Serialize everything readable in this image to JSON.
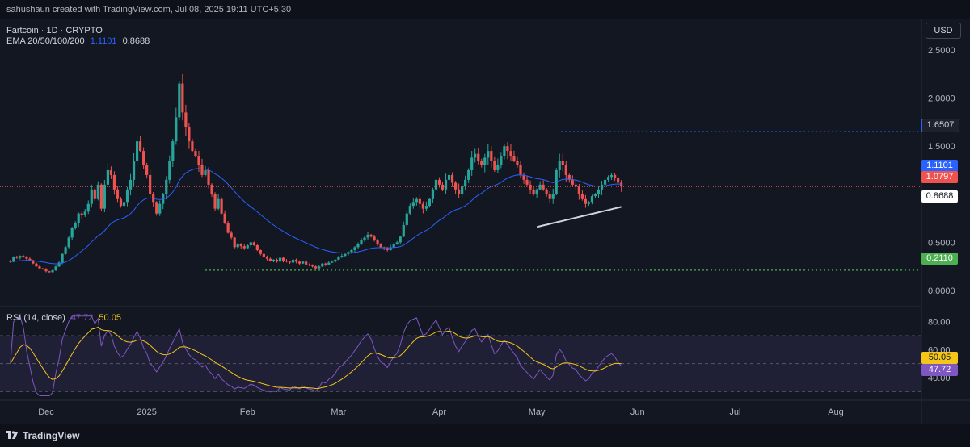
{
  "header": {
    "attribution": "sahushaun created with TradingView.com, Jul 08, 2025 19:11 UTC+5:30"
  },
  "legend": {
    "symbol": "Fartcoin · 1D · CRYPTO",
    "ema_label": "EMA 20/50/100/200",
    "ema_value_1": "1.1101",
    "ema_value_2": "0.8688"
  },
  "currency_button": "USD",
  "rsi_legend": {
    "label": "RSI (14, close)",
    "value": "47.72",
    "ma_value": "50.05"
  },
  "price_badges": {
    "resistance": "1.6507",
    "ema50": "1.1101",
    "last": "1.0797",
    "ema200": "0.8688",
    "support": "0.2110"
  },
  "rsi_badges": {
    "ma": "50.05",
    "rsi": "47.72"
  },
  "footer": {
    "brand": "TradingView"
  },
  "colors": {
    "bg": "#131722",
    "up": "#26a69a",
    "down": "#ef5350",
    "ema_blue": "#2962ff",
    "ema_white": "#d1d4dc",
    "rsi": "#7e57c2",
    "rsi_ma": "#f5c518",
    "resistance": "#2962ff",
    "support": "#4caf50"
  },
  "chart_data": [
    {
      "type": "candlestick",
      "title": "Fartcoin · 1D · CRYPTO",
      "y_axis_ticks": [
        "2.5000",
        "2.0000",
        "1.5000",
        "1.0000",
        "0.5000",
        "0.0000"
      ],
      "ylim": [
        -0.1,
        2.75
      ],
      "x_axis_ticks": [
        "Dec",
        "2025",
        "Feb",
        "Mar",
        "Apr",
        "May",
        "Jun",
        "Jul",
        "Aug"
      ],
      "x_tick_dates": [
        "2024-12-01",
        "2025-01-01",
        "2025-02-01",
        "2025-03-01",
        "2025-04-01",
        "2025-05-01",
        "2025-06-01",
        "2025-07-01",
        "2025-08-01"
      ],
      "close_series": {
        "start_date": "2024-11-20",
        "values": [
          0.3,
          0.35,
          0.34,
          0.36,
          0.35,
          0.33,
          0.31,
          0.28,
          0.25,
          0.23,
          0.22,
          0.2,
          0.19,
          0.21,
          0.25,
          0.29,
          0.38,
          0.45,
          0.55,
          0.65,
          0.7,
          0.8,
          0.78,
          0.82,
          0.9,
          1.05,
          0.95,
          1.1,
          0.85,
          1.1,
          1.25,
          1.2,
          1.05,
          0.95,
          0.88,
          0.92,
          1.05,
          1.15,
          1.35,
          1.55,
          1.45,
          1.3,
          1.2,
          1.0,
          0.92,
          0.8,
          0.9,
          1.0,
          1.15,
          1.35,
          1.55,
          1.8,
          2.15,
          1.85,
          1.7,
          1.55,
          1.45,
          1.4,
          1.3,
          1.2,
          1.25,
          1.1,
          1.0,
          0.85,
          0.95,
          0.8,
          0.7,
          0.6,
          0.55,
          0.45,
          0.48,
          0.46,
          0.44,
          0.47,
          0.5,
          0.47,
          0.42,
          0.38,
          0.35,
          0.33,
          0.31,
          0.32,
          0.3,
          0.34,
          0.31,
          0.3,
          0.29,
          0.32,
          0.3,
          0.28,
          0.3,
          0.27,
          0.26,
          0.25,
          0.23,
          0.25,
          0.28,
          0.27,
          0.29,
          0.3,
          0.32,
          0.35,
          0.36,
          0.38,
          0.4,
          0.42,
          0.45,
          0.48,
          0.52,
          0.55,
          0.58,
          0.56,
          0.52,
          0.48,
          0.45,
          0.44,
          0.42,
          0.45,
          0.48,
          0.5,
          0.56,
          0.68,
          0.8,
          0.88,
          0.92,
          0.95,
          0.9,
          0.85,
          0.88,
          0.95,
          1.05,
          1.15,
          1.1,
          1.05,
          1.15,
          1.2,
          1.12,
          1.05,
          1.0,
          1.08,
          1.15,
          1.25,
          1.38,
          1.42,
          1.35,
          1.3,
          1.38,
          1.45,
          1.35,
          1.25,
          1.3,
          1.4,
          1.5,
          1.45,
          1.4,
          1.35,
          1.3,
          1.2,
          1.15,
          1.1,
          1.05,
          1.0,
          1.05,
          1.1,
          1.05,
          1.0,
          0.95,
          1.0,
          1.25,
          1.35,
          1.3,
          1.2,
          1.15,
          1.1,
          1.08,
          1.0,
          0.95,
          0.9,
          0.92,
          0.98,
          1.0,
          1.05,
          1.1,
          1.15,
          1.18,
          1.2,
          1.17,
          1.12,
          1.08
        ]
      },
      "horizontal_levels": [
        {
          "label": "1.6507",
          "value": 1.6507,
          "style": "dotted"
        },
        {
          "label": "0.2110",
          "value": 0.211,
          "style": "dotted"
        }
      ],
      "last_price": "1.0797",
      "series": [
        {
          "name": "EMA 20/50/100/200",
          "values_at_end": "1.1101"
        },
        {
          "name": "EMA 20/50/100/200",
          "values_at_end": "0.8688"
        }
      ]
    },
    {
      "type": "line",
      "title": "RSI (14, close)",
      "y_axis_ticks": [
        "80.00",
        "60.00",
        "40.00"
      ],
      "ylim": [
        25,
        85
      ],
      "bands": [
        70,
        50,
        30
      ],
      "series": [
        {
          "name": "RSI (14, close)",
          "last": 47.72
        },
        {
          "name": "RSI-based MA",
          "last": 50.05
        }
      ]
    }
  ]
}
